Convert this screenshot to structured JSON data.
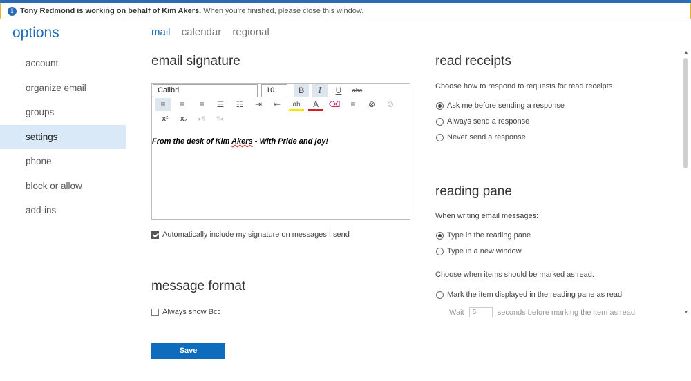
{
  "banner": {
    "actor": "Tony Redmond is working on behalf of Kim Akers.",
    "message": "When you're finished, please close this window.",
    "info_icon": "i"
  },
  "sidebar": {
    "title": "options",
    "items": [
      "account",
      "organize email",
      "groups",
      "settings",
      "phone",
      "block or allow",
      "add-ins"
    ],
    "active": "settings"
  },
  "tabs": [
    "mail",
    "calendar",
    "regional"
  ],
  "signature": {
    "heading": "email signature",
    "font_name": "Calibri",
    "font_size": "10",
    "text_before": "From the desk of Kim ",
    "text_spelling": "Akers",
    "text_after": " - With Pride and joy!",
    "auto_include_label": "Automatically include my signature on messages I send",
    "auto_include_checked": true,
    "toolbar_glyphs": {
      "bold": "B",
      "italic": "I",
      "underline": "U",
      "strike": "abc",
      "align_left": "≡",
      "align_center": "≡",
      "align_right": "≡",
      "bullets": "☰",
      "numbering": "☷",
      "indent": "⇥",
      "outdent": "⇤",
      "highlight": "ab",
      "font_color": "A",
      "eraser": "⌫",
      "link": "⊗",
      "unlink": "⊘",
      "superscript": "x²",
      "subscript": "x₂",
      "ltr": "▸¶",
      "rtl": "¶◂"
    }
  },
  "message_format": {
    "heading": "message format",
    "always_bcc": "Always show Bcc",
    "always_bcc_checked": false
  },
  "read_receipts": {
    "heading": "read receipts",
    "desc": "Choose how to respond to requests for read receipts.",
    "options": [
      "Ask me before sending a response",
      "Always send a response",
      "Never send a response"
    ],
    "selected": 0
  },
  "reading_pane": {
    "heading": "reading pane",
    "desc": "When writing email messages:",
    "options": [
      "Type in the reading pane",
      "Type in a new window"
    ],
    "selected": 0,
    "mark_desc": "Choose when items should be marked as read.",
    "mark_option": "Mark the item displayed in the reading pane as read",
    "wait_label": "Wait",
    "wait_value": "5",
    "wait_suffix": "seconds before marking the item as read"
  },
  "save_label": "Save",
  "colors": {
    "accent": "#1f6db5",
    "button": "#0f6cbd",
    "banner_border": "#e3b52d",
    "active_nav": "#d9e9f7"
  }
}
